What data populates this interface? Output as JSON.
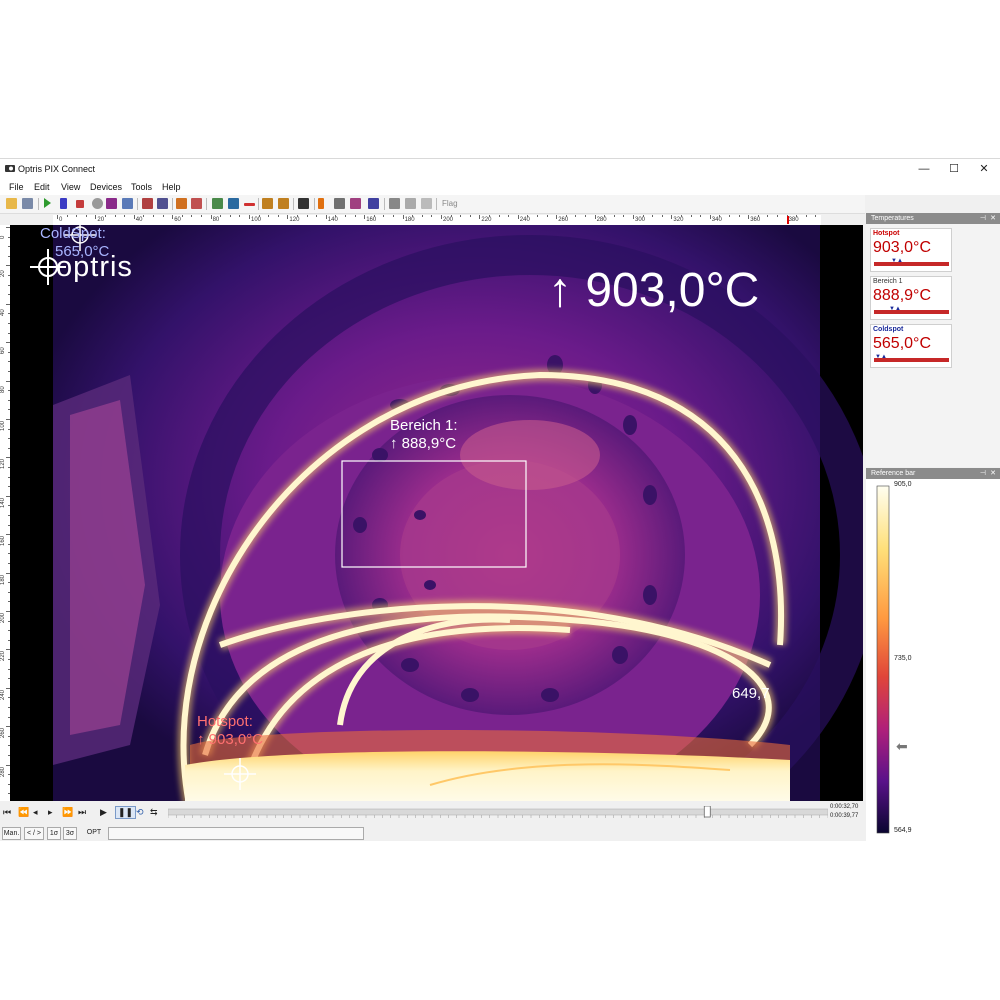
{
  "window": {
    "title": "Optris PIX Connect",
    "minimize": "—",
    "maximize": "☐",
    "close": "✕"
  },
  "menu": [
    "File",
    "Edit",
    "View",
    "Devices",
    "Tools",
    "Help"
  ],
  "toolbar": {
    "flag_label": "Flag"
  },
  "ruler": {
    "h_labels": [
      "0",
      "20",
      "40",
      "60",
      "80",
      "100",
      "120",
      "140",
      "160",
      "180",
      "200",
      "220",
      "240",
      "260",
      "280",
      "300",
      "320",
      "340",
      "360",
      "380"
    ],
    "v_labels": [
      "0",
      "20",
      "40",
      "60",
      "80",
      "100",
      "120",
      "140",
      "160",
      "180",
      "200",
      "220",
      "240",
      "260",
      "280"
    ]
  },
  "thermal": {
    "logo": "optris",
    "max_readout": "↑ 903,0°C",
    "area_label": "Bereich 1:",
    "area_value": "↑ 888,9°C",
    "hotspot_label": "Hotspot:",
    "hotspot_value": "↑ 903,0°C",
    "coldspot_label": "ColdSpot:",
    "coldspot_value": "565,0°C",
    "point_value": "649,7"
  },
  "playback": {
    "time_current": "0:00:32,70",
    "time_total": "0:00:39,77",
    "position_fraction": 0.82
  },
  "statusbar": {
    "man": "Man.",
    "range": "< / >",
    "sigma1": "1σ",
    "sigma3": "3σ",
    "opt": "OPT"
  },
  "temperatures_panel": {
    "title": "Temperatures",
    "items": [
      {
        "label": "Hotspot",
        "value": "903,0°C",
        "label_color": "#cc0000"
      },
      {
        "label": "Bereich 1",
        "value": "888,9°C",
        "label_color": "#333333"
      },
      {
        "label": "Coldspot",
        "value": "565,0°C",
        "label_color": "#1a2a9a"
      }
    ]
  },
  "reference_panel": {
    "title": "Reference bar",
    "max": "905,0",
    "mid": "735,0",
    "min": "564,9"
  },
  "colors": {
    "accent_red": "#c62828",
    "palette": [
      "#0a0020",
      "#2a0b6e",
      "#6a1b9a",
      "#c2185b",
      "#ff5722",
      "#ffc107",
      "#fffde7"
    ]
  }
}
